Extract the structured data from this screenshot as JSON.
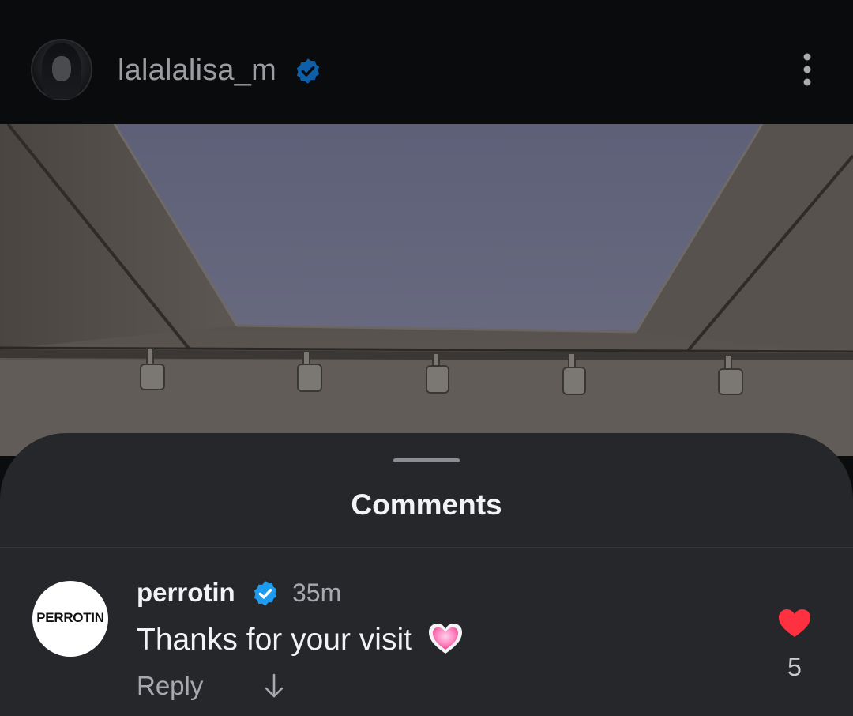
{
  "post": {
    "author": "lalalalisa_m",
    "verified": true
  },
  "sheet": {
    "title": "Comments"
  },
  "comments": [
    {
      "avatar_text": "PERROTIN",
      "user": "perrotin",
      "verified": true,
      "time": "35m",
      "text": "Thanks for your visit",
      "emoji": "pink-heart-emoji",
      "reply_label": "Reply",
      "like_count": "5"
    }
  ],
  "colors": {
    "verified_blue": "#1d9bf0",
    "like_red": "#ff3040",
    "sheet_bg": "#25272b"
  },
  "icons": {
    "more": "more-vertical-icon",
    "verified": "verified-badge-icon",
    "like": "heart-icon",
    "expand": "arrow-down-icon"
  }
}
